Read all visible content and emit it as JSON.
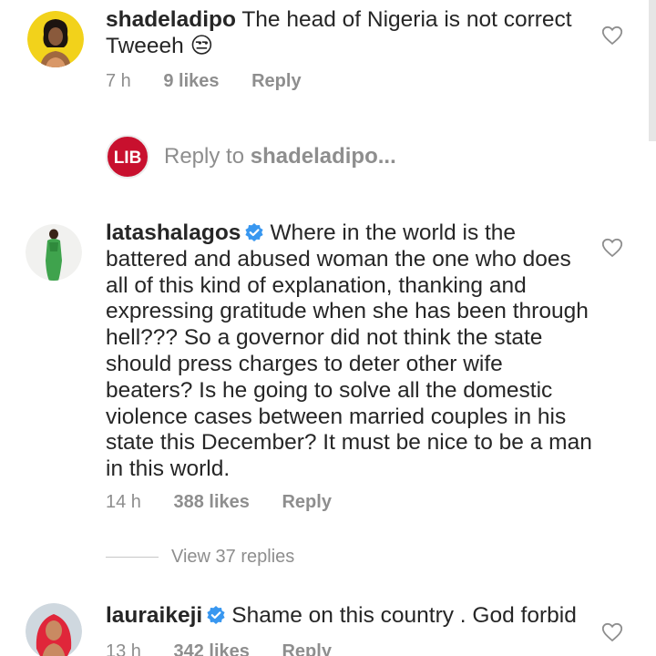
{
  "comments": [
    {
      "username": "shadeladipo",
      "verified": false,
      "text": "The head of Nigeria is not correct Tweeeh 😒",
      "time": "7 h",
      "likes": "9 likes",
      "reply_label": "Reply"
    },
    {
      "username": "latashalagos",
      "verified": true,
      "text": "Where in the world is the battered and abused woman the one who does all of this kind of explanation, thanking and expressing gratitude when she has been through hell??? So a governor did not think the state should press charges to deter other wife beaters? Is he going to solve all the domestic violence cases between married couples in his state this December? It must be nice to be a man in this world.",
      "time": "14 h",
      "likes": "388 likes",
      "reply_label": "Reply"
    },
    {
      "username": "lauraikeji",
      "verified": true,
      "text": "Shame on this country . God forbid",
      "time": "13 h",
      "likes": "342 likes",
      "reply_label": "Reply"
    }
  ],
  "reply_composer": {
    "avatar_text": "LIB",
    "prefix": "Reply to ",
    "target": "shadeladipo..."
  },
  "view_replies": "View 37 replies",
  "colors": {
    "text": "#262626",
    "secondary": "#8e8e8e",
    "verified": "#3897f0",
    "lib_brand": "#c8102e"
  }
}
